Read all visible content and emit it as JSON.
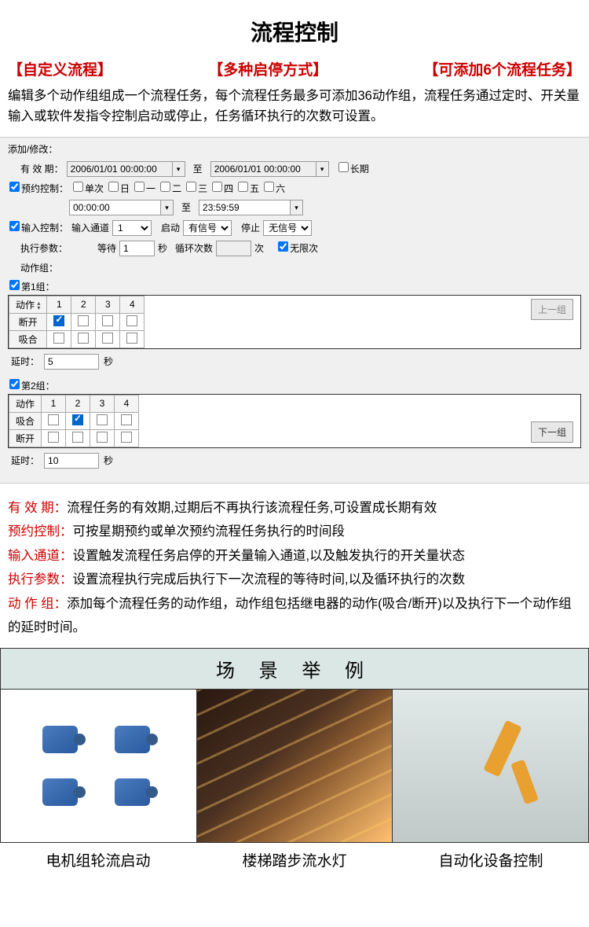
{
  "title": "流程控制",
  "tags": [
    "【自定义流程】",
    "【多种启停方式】",
    "【可添加6个流程任务】"
  ],
  "description": "编辑多个动作组组成一个流程任务，每个流程任务最多可添加36动作组，流程任务通过定时、开关量输入或软件发指令控制启动或停止，任务循环执行的次数可设置。",
  "panel": {
    "heading": "添加/修改：",
    "validity_label": "有 效 期：",
    "date_from": "2006/01/01 00:00:00",
    "to_label": "至",
    "date_to": "2006/01/01 00:00:00",
    "long_term": "长期",
    "reserve_label": "预约控制：",
    "days": [
      "单次",
      "日",
      "一",
      "二",
      "三",
      "四",
      "五",
      "六"
    ],
    "time_from": "00:00:00",
    "time_to": "23:59:59",
    "input_label": "输入控制：",
    "input_channel_label": "输入通道",
    "input_channel": "1",
    "start_label": "启动",
    "start_signal": "有信号",
    "stop_label": "停止",
    "stop_signal": "无信号",
    "exec_label": "执行参数：",
    "wait_label": "等待",
    "wait_value": "1",
    "seconds_label": "秒",
    "loop_label": "循环次数",
    "loop_value": "",
    "times_label": "次",
    "unlimited_label": "无限次",
    "group_label": "动作组：",
    "group1_label": "第1组：",
    "group2_label": "第2组：",
    "action_header": "动作",
    "cols": [
      "1",
      "2",
      "3",
      "4"
    ],
    "row_break": "断开",
    "row_close": "吸合",
    "delay_label": "延时：",
    "delay1": "5",
    "delay2": "10",
    "prev_btn": "上一组",
    "next_btn": "下一组"
  },
  "explain": [
    {
      "term": "有 效 期：",
      "text": "流程任务的有效期,过期后不再执行该流程任务,可设置成长期有效"
    },
    {
      "term": "预约控制：",
      "text": "可按星期预约或单次预约流程任务执行的时间段"
    },
    {
      "term": "输入通道：",
      "text": "设置触发流程任务启停的开关量输入通道,以及触发执行的开关量状态"
    },
    {
      "term": "执行参数：",
      "text": "设置流程执行完成后执行下一次流程的等待时间,以及循环执行的次数"
    },
    {
      "term": "动 作 组：",
      "text": "添加每个流程任务的动作组，动作组包括继电器的动作(吸合/断开)以及执行下一个动作组的延时时间。"
    }
  ],
  "examples": {
    "title": "场 景 举 例",
    "captions": [
      "电机组轮流启动",
      "楼梯踏步流水灯",
      "自动化设备控制"
    ]
  }
}
